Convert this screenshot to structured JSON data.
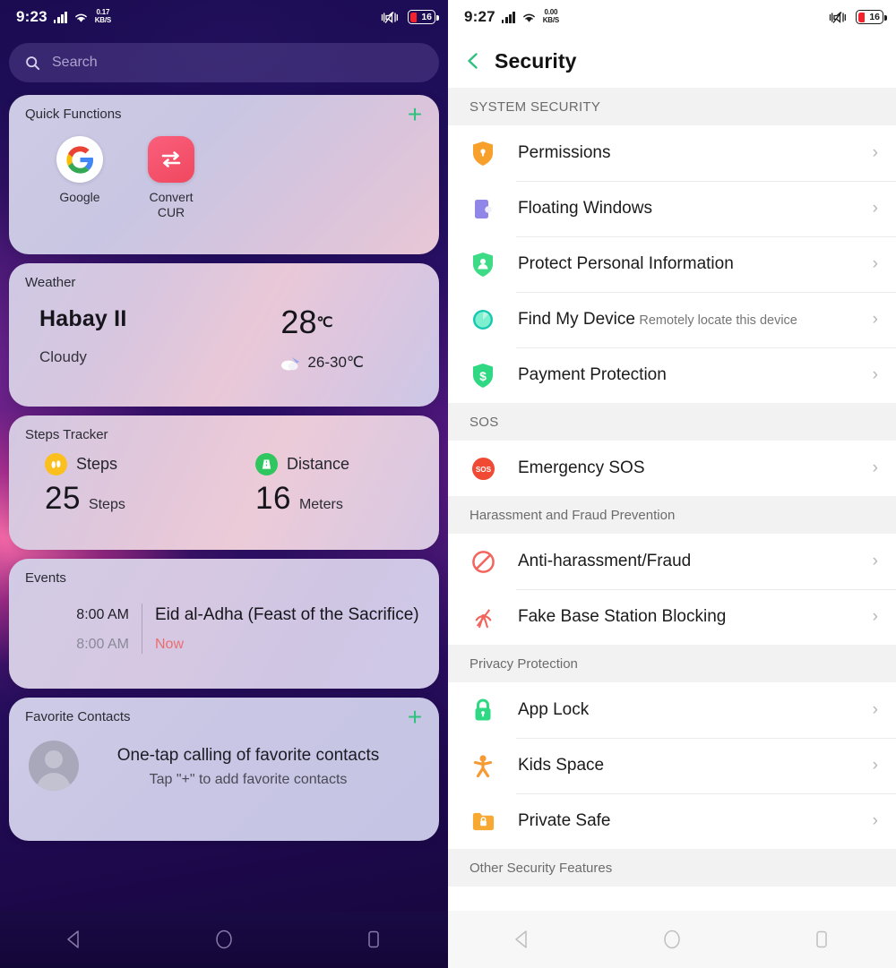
{
  "left_panel": {
    "status_bar": {
      "time": "9:23",
      "network_speed_value": "0.17",
      "network_speed_unit": "KB/S",
      "battery_percent": "16",
      "signal_icon": "signal-bars-icon",
      "wifi_icon": "wifi-icon",
      "mute_icon": "vibrate-mute-icon",
      "battery_icon": "battery-icon"
    },
    "search": {
      "placeholder": "Search",
      "icon": "search-icon"
    },
    "quick_functions": {
      "title": "Quick Functions",
      "add_label": "+",
      "items": [
        {
          "label": "Google",
          "icon": "google-icon"
        },
        {
          "label": "Convert CUR",
          "icon": "currency-convert-icon"
        }
      ]
    },
    "weather": {
      "title": "Weather",
      "city": "Habay II",
      "condition": "Cloudy",
      "temperature": "28",
      "temperature_unit": "℃",
      "range": "26-30℃",
      "condition_icon": "cloudy-icon"
    },
    "steps_tracker": {
      "title": "Steps Tracker",
      "metrics": [
        {
          "label": "Steps",
          "value": "25",
          "unit": "Steps",
          "icon": "footsteps-icon"
        },
        {
          "label": "Distance",
          "value": "16",
          "unit": "Meters",
          "icon": "road-distance-icon"
        }
      ]
    },
    "events": {
      "title": "Events",
      "rows": [
        {
          "time": "8:00 AM",
          "text": "Eid al-Adha (Feast of the Sacrifice)"
        },
        {
          "time": "8:00 AM",
          "text": "Now"
        }
      ]
    },
    "favorite_contacts": {
      "title": "Favorite Contacts",
      "add_label": "+",
      "headline": "One-tap calling of favorite contacts",
      "subtext": "Tap \"+\" to add favorite contacts",
      "avatar_icon": "contact-avatar-icon"
    },
    "nav_bar": {
      "back": "back-triangle-icon",
      "home": "home-circle-icon",
      "recents": "recents-square-icon"
    }
  },
  "right_panel": {
    "status_bar": {
      "time": "9:27",
      "network_speed_value": "0.00",
      "network_speed_unit": "KB/S",
      "battery_percent": "16"
    },
    "header": {
      "title": "Security",
      "back_icon": "back-chevron-icon"
    },
    "sections": [
      {
        "header": "SYSTEM SECURITY",
        "items": [
          {
            "label": "Permissions",
            "sub": "",
            "icon": "shield-key-icon",
            "chevron": "›"
          },
          {
            "label": "Floating Windows",
            "sub": "",
            "icon": "floating-window-icon",
            "chevron": "›"
          },
          {
            "label": "Protect Personal Information",
            "sub": "",
            "icon": "shield-person-icon",
            "chevron": "›"
          },
          {
            "label": "Find My Device",
            "sub": "Remotely locate this device",
            "icon": "find-device-icon",
            "chevron": "›"
          },
          {
            "label": "Payment Protection",
            "sub": "",
            "icon": "shield-dollar-icon",
            "chevron": "›"
          }
        ]
      },
      {
        "header": "SOS",
        "items": [
          {
            "label": "Emergency SOS",
            "sub": "",
            "icon": "sos-icon",
            "chevron": "›"
          }
        ]
      },
      {
        "header": "Harassment and Fraud Prevention",
        "items": [
          {
            "label": "Anti-harassment/Fraud",
            "sub": "",
            "icon": "block-circle-icon",
            "chevron": "›"
          },
          {
            "label": "Fake Base Station Blocking",
            "sub": "",
            "icon": "base-station-icon",
            "chevron": "›"
          }
        ]
      },
      {
        "header": "Privacy Protection",
        "items": [
          {
            "label": "App Lock",
            "sub": "",
            "icon": "padlock-icon",
            "chevron": "›"
          },
          {
            "label": "Kids Space",
            "sub": "",
            "icon": "kids-person-icon",
            "chevron": "›"
          },
          {
            "label": "Private Safe",
            "sub": "",
            "icon": "locked-folder-icon",
            "chevron": "›"
          }
        ]
      },
      {
        "header": "Other Security Features",
        "items": []
      }
    ],
    "nav_bar": {
      "back": "back-triangle-icon",
      "home": "home-circle-icon",
      "recents": "recents-square-icon"
    }
  },
  "colors": {
    "accent_green": "#2ec27e",
    "battery_red": "#f5222d",
    "now_red": "#ea6e70",
    "section_bg": "#f2f2f2"
  }
}
